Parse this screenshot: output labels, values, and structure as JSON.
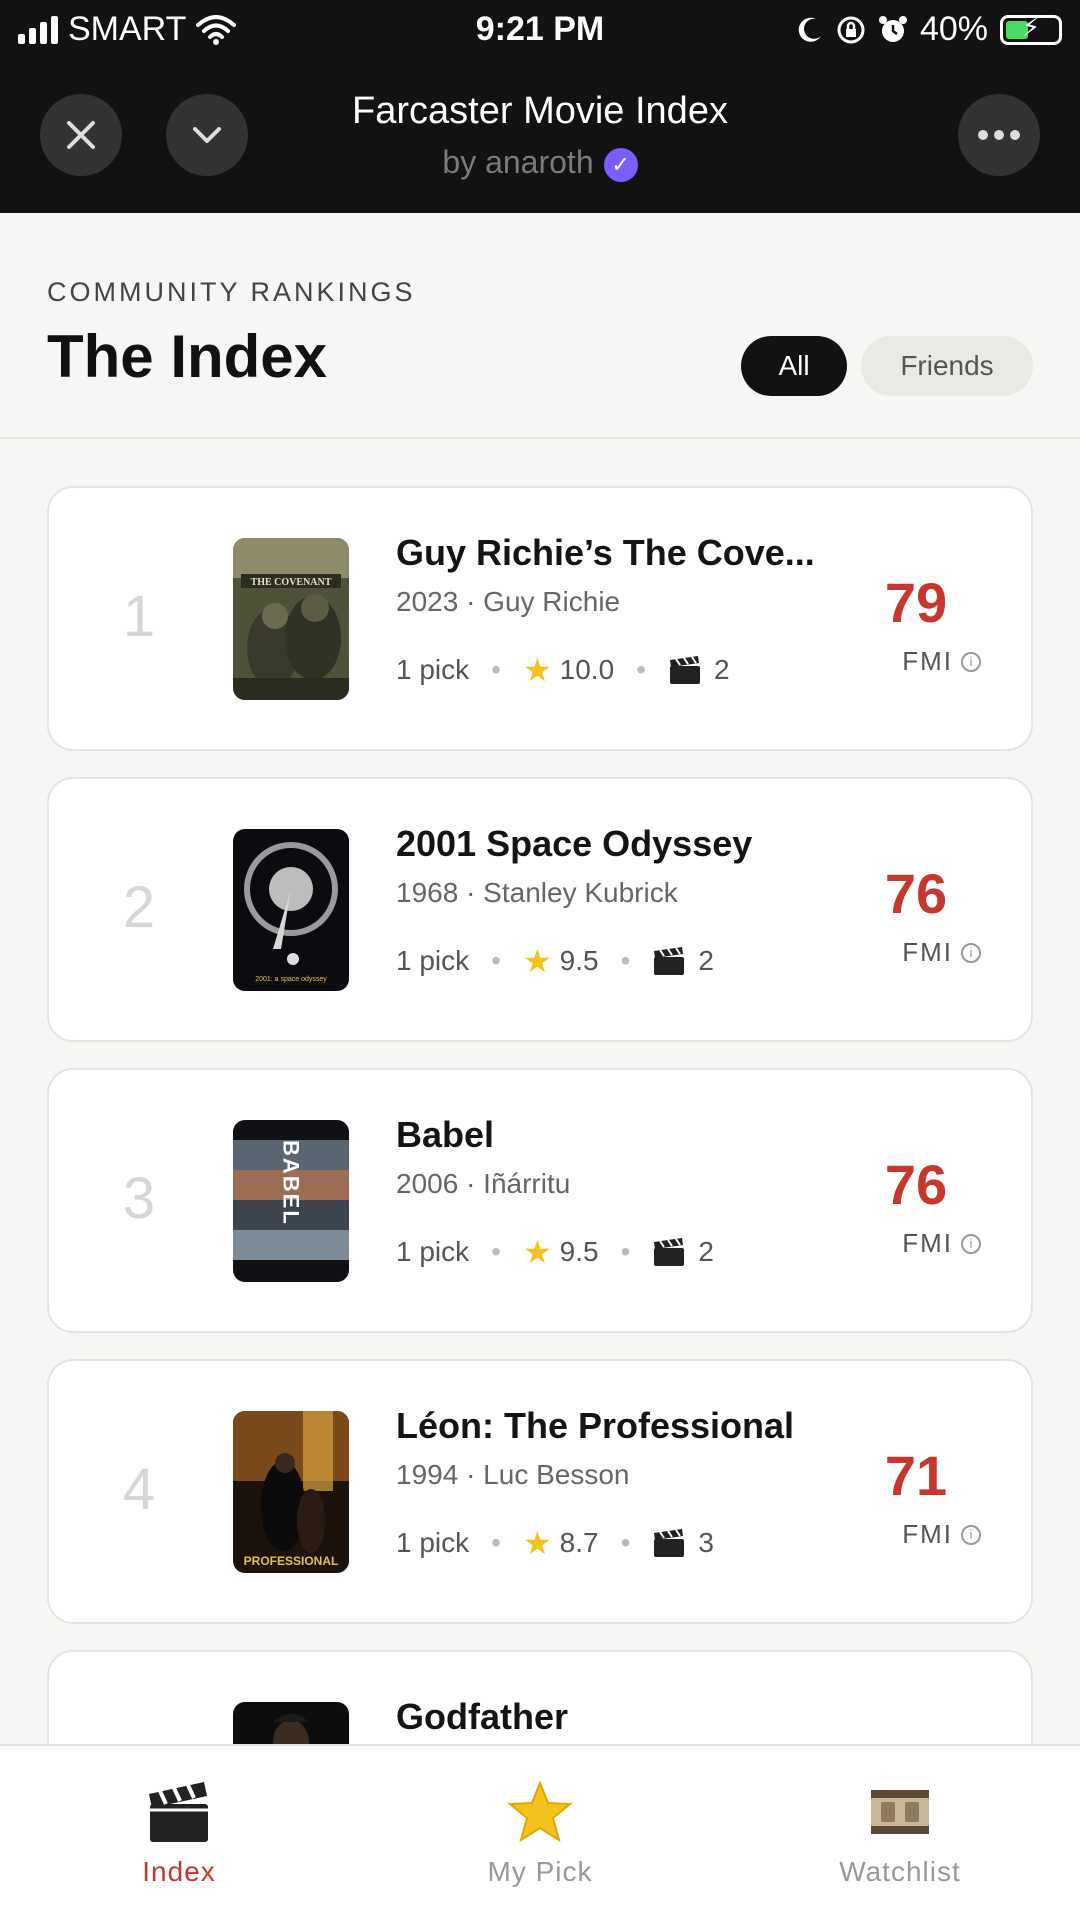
{
  "status_bar": {
    "carrier": "SMART",
    "time": "9:21 PM",
    "battery": "40%"
  },
  "header": {
    "title": "Farcaster Movie Index",
    "byline": "by anaroth"
  },
  "page": {
    "section_label": "COMMUNITY RANKINGS",
    "title": "The Index",
    "filters": [
      "All",
      "Friends"
    ],
    "active_filter": "All"
  },
  "movies": [
    {
      "rank": "1",
      "title": "Guy Richie’s The Cove...",
      "sub": "2023 · Guy Richie",
      "picks": "1 pick",
      "rating": "10.0",
      "clips": "2",
      "score": "79",
      "score_label": "FMI",
      "poster_text": "THE COVENANT"
    },
    {
      "rank": "2",
      "title": "2001 Space Odyssey",
      "sub": "1968 · Stanley Kubrick",
      "picks": "1 pick",
      "rating": "9.5",
      "clips": "2",
      "score": "76",
      "score_label": "FMI",
      "poster_text": "2001: a space odyssey"
    },
    {
      "rank": "3",
      "title": "Babel",
      "sub": "2006 · Iñárritu",
      "picks": "1 pick",
      "rating": "9.5",
      "clips": "2",
      "score": "76",
      "score_label": "FMI",
      "poster_text": "BABEL"
    },
    {
      "rank": "4",
      "title": "Léon: The Professional",
      "sub": "1994 · Luc Besson",
      "picks": "1 pick",
      "rating": "8.7",
      "clips": "3",
      "score": "71",
      "score_label": "FMI",
      "poster_text": "PROFESSIONAL"
    },
    {
      "rank": "",
      "title": "Godfather",
      "sub": "",
      "picks": "",
      "rating": "",
      "clips": "",
      "score": "",
      "score_label": "",
      "poster_text": ""
    }
  ],
  "tabs": [
    {
      "label": "Index",
      "icon": "clapperboard-icon",
      "active": true
    },
    {
      "label": "My Pick",
      "icon": "star-icon",
      "active": false
    },
    {
      "label": "Watchlist",
      "icon": "film-reel-icon",
      "active": false
    }
  ],
  "colors": {
    "accent_red": "#c8372d",
    "header_bg": "#121212",
    "verified": "#7b5cff",
    "star": "#f4c21b"
  }
}
